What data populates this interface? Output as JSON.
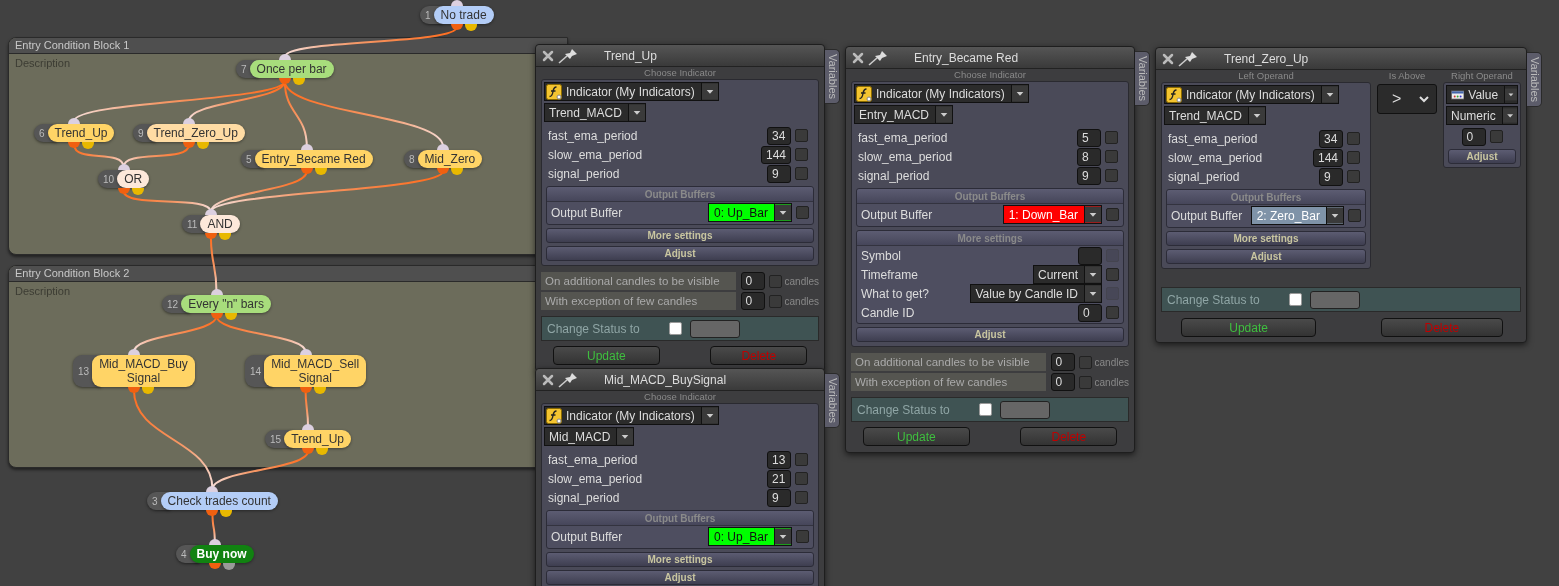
{
  "canvas": {
    "blocks": [
      {
        "title": "Entry Condition Block 1",
        "description": "Description"
      },
      {
        "title": "Entry Condition Block 2",
        "description": "Description"
      }
    ],
    "nodes": [
      {
        "number": "1",
        "label": "No trade",
        "color": "#b3cdf7",
        "kind": "normal"
      },
      {
        "number": "7",
        "label": "Once per bar",
        "color": "#a8dd7c",
        "kind": "normal"
      },
      {
        "number": "6",
        "label": "Trend_Up",
        "color": "#ffd466",
        "kind": "normal"
      },
      {
        "number": "9",
        "label": "Trend_Zero_Up",
        "color": "#ffdca4",
        "kind": "normal"
      },
      {
        "number": "5",
        "label": "Entry_Became Red",
        "color": "#ffd466",
        "kind": "normal"
      },
      {
        "number": "8",
        "label": "Mid_Zero",
        "color": "#ffd466",
        "kind": "normal"
      },
      {
        "number": "10",
        "label": "OR",
        "color": "#fde8da",
        "kind": "normal"
      },
      {
        "number": "11",
        "label": "AND",
        "color": "#fde8da",
        "kind": "normal"
      },
      {
        "number": "12",
        "label": "Every \"n\" bars",
        "color": "#a8dd7c",
        "kind": "normal"
      },
      {
        "number": "13",
        "label": "Mid_MACD_Buy\nSignal",
        "color": "#ffd466",
        "kind": "normal"
      },
      {
        "number": "14",
        "label": "Mid_MACD_Sell\nSignal",
        "color": "#ffd466",
        "kind": "normal"
      },
      {
        "number": "15",
        "label": "Trend_Up",
        "color": "#ffd466",
        "kind": "normal"
      },
      {
        "number": "3",
        "label": "Check trades count",
        "color": "#b3cdf7",
        "kind": "normal"
      },
      {
        "number": "4",
        "label": "Buy now",
        "color": "#118211",
        "kind": "action"
      }
    ]
  },
  "panels": [
    {
      "title": "Trend_Up",
      "kind": "indicator",
      "side_tab": "Variables",
      "operand": {
        "caption": "Choose Indicator",
        "source": "Indicator (My Indicators)",
        "indicator": "Trend_MACD",
        "params": [
          {
            "name": "fast_ema_period",
            "value": "34",
            "checked": false
          },
          {
            "name": "slow_ema_period",
            "value": "144",
            "checked": false
          },
          {
            "name": "signal_period",
            "value": "9",
            "checked": false
          }
        ],
        "buffers": {
          "header": "Output Buffers",
          "label": "Output Buffer",
          "value": "0: Up_Bar",
          "color": "#00ff00",
          "checked": false
        },
        "more_settings": {
          "label": "More settings",
          "expanded": false
        },
        "adjust": "Adjust"
      },
      "candles": [
        {
          "label": "On additional candles to be visible",
          "value": "0",
          "unit": "candles",
          "checked": false
        },
        {
          "label": "With exception of few candles",
          "value": "0",
          "unit": "candles",
          "checked": false
        }
      ],
      "status": {
        "label": "Change Status to",
        "checked": false
      },
      "buttons": [
        {
          "label": "Update",
          "kind": "update"
        },
        {
          "label": "Delete",
          "kind": "delete"
        }
      ]
    },
    {
      "title": "Entry_Became Red",
      "kind": "indicator",
      "side_tab": "Variables",
      "operand": {
        "caption": "Choose Indicator",
        "source": "Indicator (My Indicators)",
        "indicator": "Entry_MACD",
        "params": [
          {
            "name": "fast_ema_period",
            "value": "5",
            "checked": false
          },
          {
            "name": "slow_ema_period",
            "value": "8",
            "checked": false
          },
          {
            "name": "signal_period",
            "value": "9",
            "checked": false
          }
        ],
        "buffers": {
          "header": "Output Buffers",
          "label": "Output Buffer",
          "value": "1: Down_Bar",
          "color": "#ff0000",
          "checked": false
        },
        "more_settings": {
          "label": "More settings",
          "expanded": true,
          "rows": [
            {
              "name": "Symbol",
              "kind": "input",
              "checked": false,
              "disabled": true
            },
            {
              "name": "Timeframe",
              "kind": "select",
              "value": "Current",
              "checked": false,
              "disabled": false
            },
            {
              "name": "What to get?",
              "kind": "select",
              "value": "Value by Candle ID",
              "checked": false,
              "disabled": true
            },
            {
              "name": "Candle ID",
              "kind": "input",
              "value": "0",
              "checked": false,
              "disabled": false
            }
          ]
        },
        "adjust": "Adjust"
      },
      "candles": [
        {
          "label": "On additional candles to be visible",
          "value": "0",
          "unit": "candles",
          "checked": false
        },
        {
          "label": "With exception of few candles",
          "value": "0",
          "unit": "candles",
          "checked": false
        }
      ],
      "status": {
        "label": "Change Status to",
        "checked": false
      },
      "buttons": [
        {
          "label": "Update",
          "kind": "update"
        },
        {
          "label": "Delete",
          "kind": "delete"
        }
      ]
    },
    {
      "title": "Trend_Zero_Up",
      "kind": "comparison",
      "side_tab": "Variables",
      "operand": {
        "caption": "Left Operand",
        "source": "Indicator (My Indicators)",
        "indicator": "Trend_MACD",
        "params": [
          {
            "name": "fast_ema_period",
            "value": "34",
            "checked": false
          },
          {
            "name": "slow_ema_period",
            "value": "144",
            "checked": false
          },
          {
            "name": "signal_period",
            "value": "9",
            "checked": false
          }
        ],
        "buffers": {
          "header": "Output Buffers",
          "label": "Output Buffer",
          "value": "2: Zero_Bar",
          "color": "#7f93a8",
          "checked": false
        },
        "more_settings": {
          "label": "More settings",
          "expanded": false
        },
        "adjust": "Adjust"
      },
      "operator": {
        "caption": "Is Above",
        "value": ">"
      },
      "right_operand": {
        "caption": "Right Operand",
        "source": "Value",
        "type": "Numeric",
        "value": "0",
        "checked": false,
        "adjust": "Adjust"
      },
      "status": {
        "label": "Change Status to",
        "checked": false
      },
      "buttons": [
        {
          "label": "Update",
          "kind": "update"
        },
        {
          "label": "Delete",
          "kind": "delete"
        }
      ]
    },
    {
      "title": "Mid_MACD_BuySignal",
      "kind": "indicator",
      "side_tab": "Variables",
      "operand": {
        "caption": "Choose Indicator",
        "source": "Indicator (My Indicators)",
        "indicator": "Mid_MACD",
        "params": [
          {
            "name": "fast_ema_period",
            "value": "13",
            "checked": false
          },
          {
            "name": "slow_ema_period",
            "value": "21",
            "checked": false
          },
          {
            "name": "signal_period",
            "value": "9",
            "checked": false
          }
        ],
        "buffers": {
          "header": "Output Buffers",
          "label": "Output Buffer",
          "value": "0: Up_Bar",
          "color": "#00ff00",
          "checked": false
        },
        "more_settings": {
          "label": "More settings",
          "expanded": false
        },
        "adjust": "Adjust"
      }
    }
  ]
}
